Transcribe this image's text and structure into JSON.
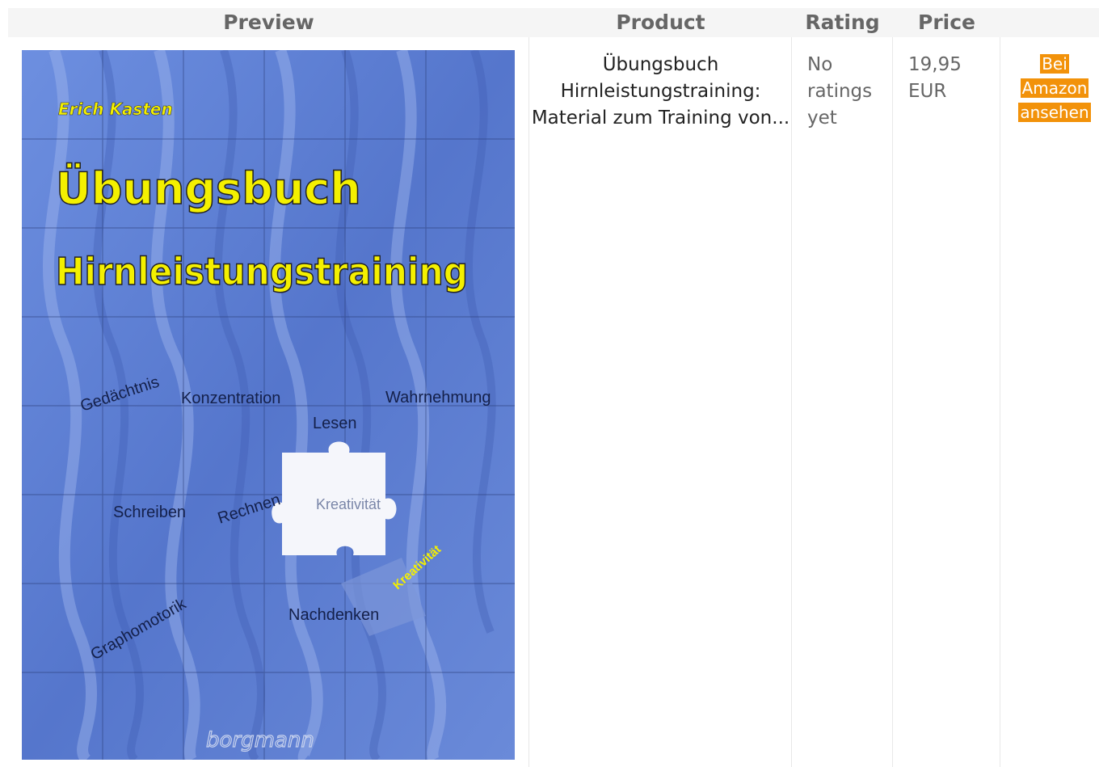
{
  "table": {
    "headers": {
      "preview": "Preview",
      "product": "Product",
      "rating": "Rating",
      "price": "Price"
    },
    "row": {
      "product_title": "Übungsbuch Hirnleistungstraining: Material zum Training von...",
      "rating": "No ratings yet",
      "price": "19,95 EUR",
      "buy_button": [
        "Bei",
        "Amazon",
        "ansehen"
      ]
    }
  },
  "cover": {
    "author": "Erich Kasten",
    "title_line1": "Übungsbuch",
    "title_line2": "Hirnleistungstraining",
    "words": {
      "gedaechtnis": "Gedächtnis",
      "konzentration": "Konzentration",
      "wahrnehmung": "Wahrnehmung",
      "lesen": "Lesen",
      "schreiben": "Schreiben",
      "rechnen": "Rechnen",
      "kreativitaet": "Kreativität",
      "kreativitaet2": "Kreativität",
      "graphomotorik": "Graphomotorik",
      "nachdenken": "Nachdenken"
    },
    "publisher": "borgmann",
    "colors": {
      "background": "#5b7fd1",
      "title": "#f4f000",
      "text": "#14204a"
    }
  }
}
